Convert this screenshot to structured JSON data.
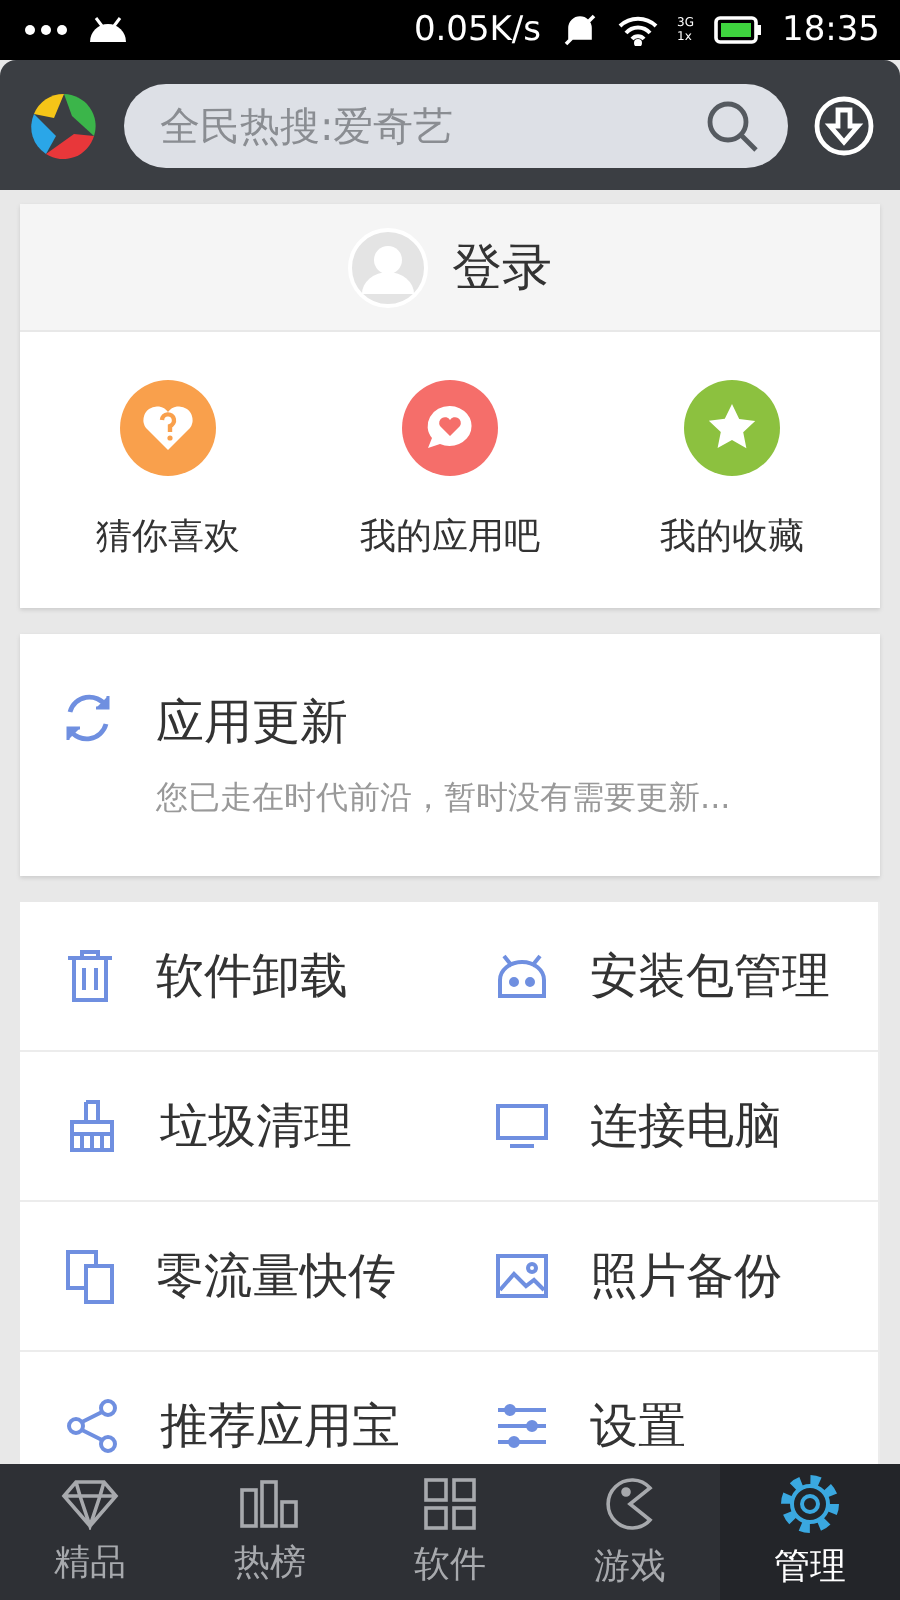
{
  "status_bar": {
    "speed": "0.05K/s",
    "network_top": "3G",
    "network_bottom": "1x",
    "time": "18:35"
  },
  "header": {
    "search": {
      "placeholder": "全民热搜:爱奇艺"
    }
  },
  "login": {
    "label": "登录"
  },
  "shortcuts": [
    {
      "kind": "heart-question",
      "label": "猜你喜欢",
      "color": "#f9a04c"
    },
    {
      "kind": "chat-heart",
      "label": "我的应用吧",
      "color": "#f56e6a"
    },
    {
      "kind": "star",
      "label": "我的收藏",
      "color": "#8cc13f"
    }
  ],
  "update": {
    "title": "应用更新",
    "subtitle": "您已走在时代前沿，暂时没有需要更新..."
  },
  "tools": [
    {
      "kind": "trash",
      "label": "软件卸载"
    },
    {
      "kind": "android",
      "label": "安装包管理"
    },
    {
      "kind": "broom",
      "label": "垃圾清理"
    },
    {
      "kind": "monitor",
      "label": "连接电脑"
    },
    {
      "kind": "devices",
      "label": "零流量快传"
    },
    {
      "kind": "image",
      "label": "照片备份"
    },
    {
      "kind": "share",
      "label": "推荐应用宝"
    },
    {
      "kind": "sliders",
      "label": "设置"
    }
  ],
  "tabs": [
    {
      "kind": "diamond",
      "label": "精品",
      "selected": false
    },
    {
      "kind": "bars",
      "label": "热榜",
      "selected": false
    },
    {
      "kind": "grid",
      "label": "软件",
      "selected": false
    },
    {
      "kind": "pacman",
      "label": "游戏",
      "selected": false
    },
    {
      "kind": "gear",
      "label": "管理",
      "selected": true
    }
  ]
}
